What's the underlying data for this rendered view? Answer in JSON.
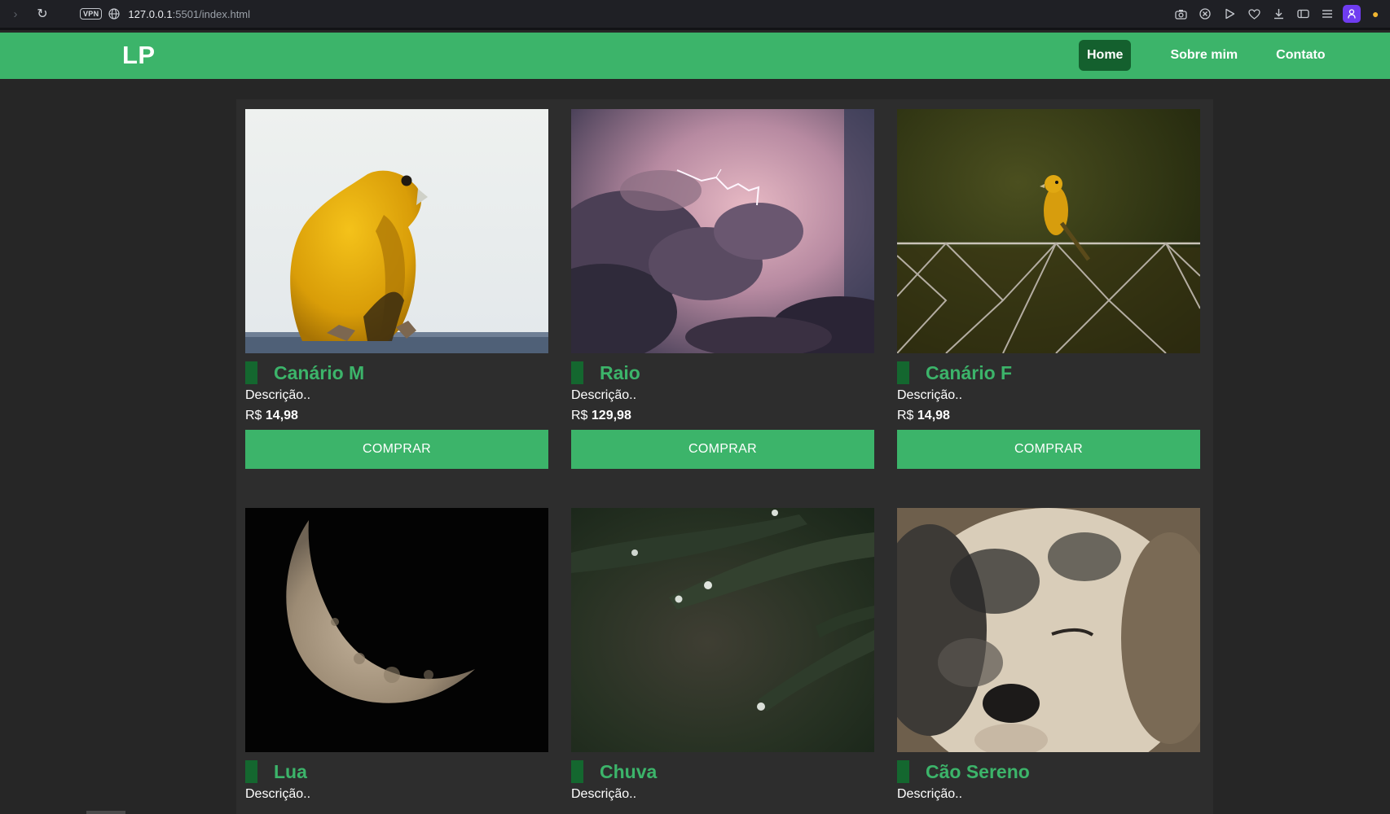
{
  "browser": {
    "vpn_label": "VPN",
    "url_host": "127.0.0.1",
    "url_path": ":5501/index.html"
  },
  "site": {
    "logo": "LP",
    "nav": [
      {
        "label": "Home",
        "active": true
      },
      {
        "label": "Sobre mim",
        "active": false
      },
      {
        "label": "Contato",
        "active": false
      }
    ]
  },
  "products": [
    {
      "name": "Canário M",
      "description": "Descrição..",
      "currency": "R$",
      "price": "14,98",
      "button": "COMPRAR",
      "image": "yellow canary perched on a ledge"
    },
    {
      "name": "Raio",
      "description": "Descrição..",
      "currency": "R$",
      "price": "129,98",
      "button": "COMPRAR",
      "image": "lightning in purple storm clouds"
    },
    {
      "name": "Canário F",
      "description": "Descrição..",
      "currency": "R$",
      "price": "14,98",
      "button": "COMPRAR",
      "image": "canary on a chain-link fence"
    },
    {
      "name": "Lua",
      "description": "Descrição..",
      "image": "crescent moon on black sky"
    },
    {
      "name": "Chuva",
      "description": "Descrição..",
      "image": "raindrops on green plant leaves"
    },
    {
      "name": "Cão Sereno",
      "description": "Descrição..",
      "image": "close-up of a sleeping dog"
    }
  ],
  "colors": {
    "brand_green": "#3cb46a",
    "dark_green": "#14672f",
    "background": "#262626",
    "panel": "#2d2d2d"
  }
}
